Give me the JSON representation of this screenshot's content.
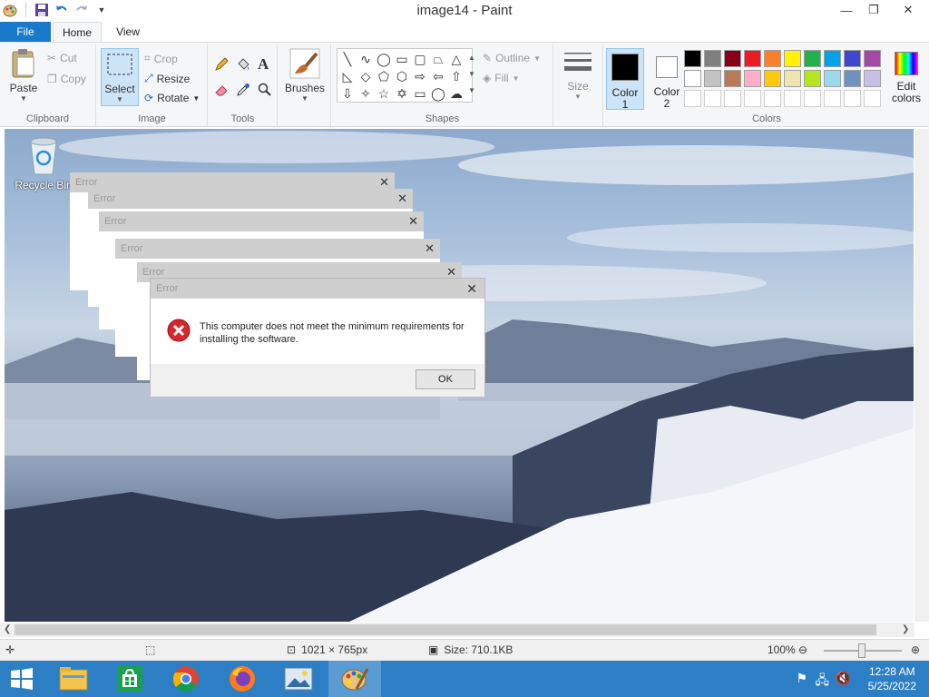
{
  "window": {
    "title": "image14 - Paint",
    "minimize": "—",
    "maximize": "❐",
    "close": "✕"
  },
  "tabs": {
    "file": "File",
    "home": "Home",
    "view": "View"
  },
  "ribbon": {
    "clipboard": {
      "label": "Clipboard",
      "paste": "Paste",
      "cut": "Cut",
      "copy": "Copy"
    },
    "image": {
      "label": "Image",
      "select": "Select",
      "crop": "Crop",
      "resize": "Resize",
      "rotate": "Rotate"
    },
    "tools": {
      "label": "Tools"
    },
    "brushes": {
      "label": "Brushes"
    },
    "shapes": {
      "label": "Shapes",
      "outline": "Outline",
      "fill": "Fill"
    },
    "size": {
      "label": "Size"
    },
    "colors": {
      "label": "Colors",
      "color1": "Color",
      "color1_num": "1",
      "color2": "Color",
      "color2_num": "2",
      "edit": "Edit",
      "edit2": "colors",
      "color1_value": "#000000",
      "color2_value": "#ffffff",
      "palette_row1": [
        "#000000",
        "#7f7f7f",
        "#880015",
        "#ed1c24",
        "#ff7f27",
        "#fff200",
        "#22b14c",
        "#00a2e8",
        "#3f48cc",
        "#a349a4"
      ],
      "palette_row2": [
        "#ffffff",
        "#c3c3c3",
        "#b97a57",
        "#ffaec9",
        "#ffc90e",
        "#efe4b0",
        "#b5e61d",
        "#99d9ea",
        "#7092be",
        "#c8bfe7"
      ]
    }
  },
  "canvas": {
    "desktop_icon": "Recycle Bin",
    "ghost_dialog_title": "Error",
    "dialog": {
      "title": "Error",
      "close": "✕",
      "message": "This computer does not meet the minimum requirements for installing the software.",
      "ok": "OK"
    }
  },
  "status": {
    "dimensions": "1021 × 765px",
    "size": "Size: 710.1KB",
    "zoom": "100%",
    "zoom_level": 1.0
  },
  "taskbar": {
    "time": "12:28 AM",
    "date": "5/25/2022",
    "apps": [
      "start",
      "file-explorer",
      "store",
      "chrome",
      "firefox",
      "photos",
      "paint"
    ]
  }
}
